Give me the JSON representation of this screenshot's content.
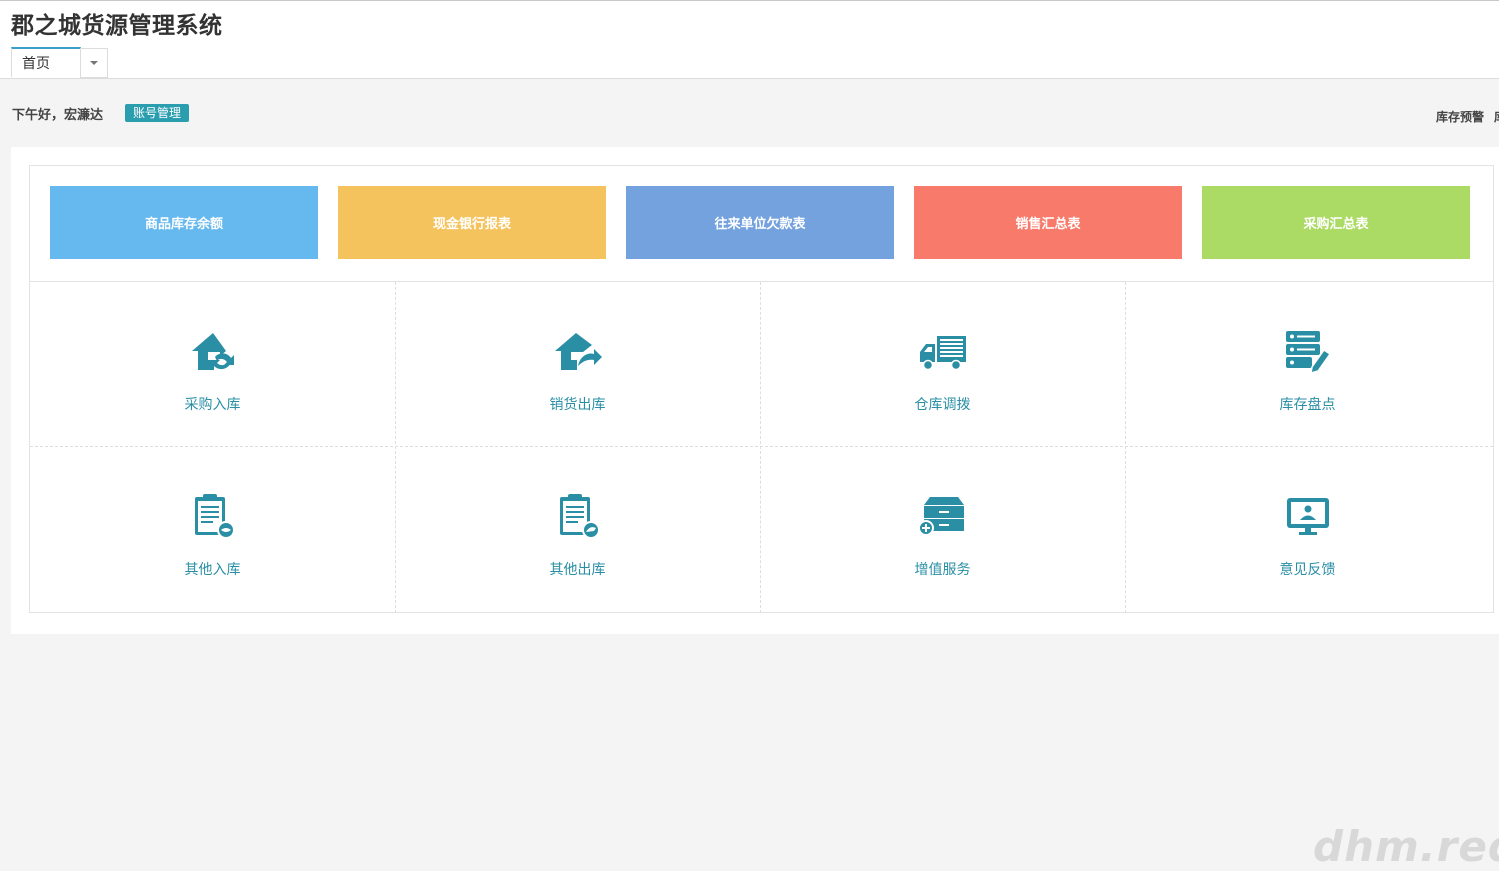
{
  "app": {
    "title": "郡之城货源管理系统"
  },
  "tabs": [
    {
      "label": "首页"
    }
  ],
  "greeting": {
    "text": "下午好，宏濂达",
    "account_button": "账号管理"
  },
  "stock_warning": {
    "label": "库存预警",
    "clipped_next": "库"
  },
  "reports": [
    {
      "label": "商品库存余额",
      "color": "#66b9ef"
    },
    {
      "label": "现金银行报表",
      "color": "#f5c35e"
    },
    {
      "label": "往来单位欠款表",
      "color": "#73a2de"
    },
    {
      "label": "销售汇总表",
      "color": "#f77a6a"
    },
    {
      "label": "采购汇总表",
      "color": "#acdb65"
    }
  ],
  "features": [
    {
      "label": "采购入库",
      "icon": "house-arrow-in-icon"
    },
    {
      "label": "销货出库",
      "icon": "house-arrow-out-icon"
    },
    {
      "label": "仓库调拨",
      "icon": "truck-icon"
    },
    {
      "label": "库存盘点",
      "icon": "server-edit-icon"
    },
    {
      "label": "其他入库",
      "icon": "clipboard-in-icon"
    },
    {
      "label": "其他出库",
      "icon": "clipboard-out-icon"
    },
    {
      "label": "增值服务",
      "icon": "cabinet-plus-icon"
    },
    {
      "label": "意见反馈",
      "icon": "monitor-user-icon"
    }
  ],
  "watermark": "dhm.red",
  "colors": {
    "accent": "#2a9daf",
    "icon": "#2a8fa5"
  }
}
